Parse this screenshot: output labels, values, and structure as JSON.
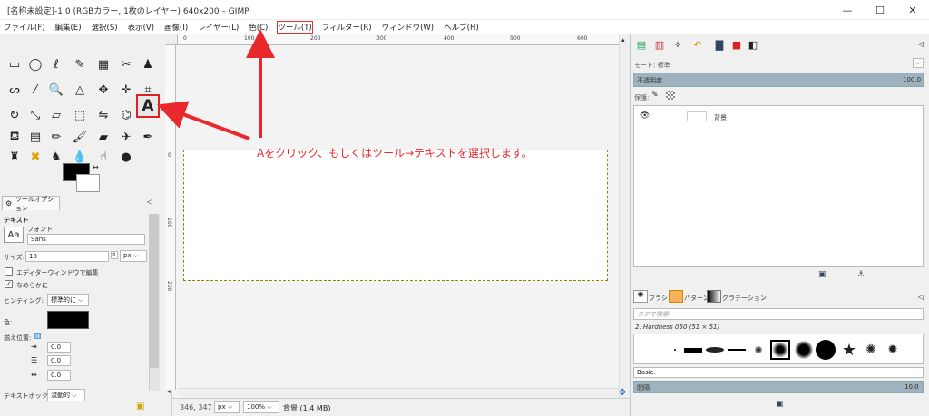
{
  "window": {
    "title": "[名称未設定]-1.0 (RGBカラー, 1枚のレイヤー) 640x200 – GIMP",
    "minimize": "—",
    "maximize": "☐",
    "close": "✕"
  },
  "menu": [
    "ファイル(F)",
    "編集(E)",
    "選択(S)",
    "表示(V)",
    "画像(I)",
    "レイヤー(L)",
    "色(C)",
    "ツール(T)",
    "フィルター(R)",
    "ウィンドウ(W)",
    "ヘルプ(H)"
  ],
  "annotation": "Aをクリック、もしくはツール→テキストを選択します。",
  "accent_color": "#e8282b",
  "tool_options": {
    "tab_label": "ツールオプション",
    "tool_name": "テキスト",
    "font_label": "フォント",
    "font_value": "Sans",
    "font_preview": "Aa",
    "size_label": "サイズ:",
    "size_value": "18",
    "size_unit": "px",
    "editor_label": "エディターウィンドウで編集",
    "smooth_label": "なめらかに",
    "hinting_label": "ヒンティング:",
    "hinting_value": "標準的に",
    "color_label": "色:",
    "justify_label": "揃え位置:",
    "indent_value": "0.0",
    "line_spacing_value": "0.0",
    "letter_spacing_value": "0.0",
    "textbox_label": "テキストボックス:",
    "textbox_value": "流動的"
  },
  "rulers": {
    "top": [
      "0",
      "100",
      "200",
      "300",
      "400",
      "500",
      "600"
    ],
    "left": [
      "0",
      "100",
      "200"
    ]
  },
  "status": {
    "coords": "346, 347",
    "unit": "px",
    "zoom": "100%",
    "info": "背景 (1.4 MB)"
  },
  "layers_panel": {
    "mode_label": "モード: 標準",
    "opacity_label": "不透明度",
    "opacity_value": "100.0",
    "lock_label": "保護:",
    "layer_name": "背景"
  },
  "brushes_panel": {
    "tab_brush": "ブラシ",
    "tab_pattern": "パターン",
    "tab_gradient": "グラデーション",
    "search_placeholder": "タグで検索",
    "brush_name": "2. Hardness 050 (51 × 51)",
    "preset": "Basic.",
    "spacing_label": "間隔",
    "spacing_value": "10.0"
  }
}
